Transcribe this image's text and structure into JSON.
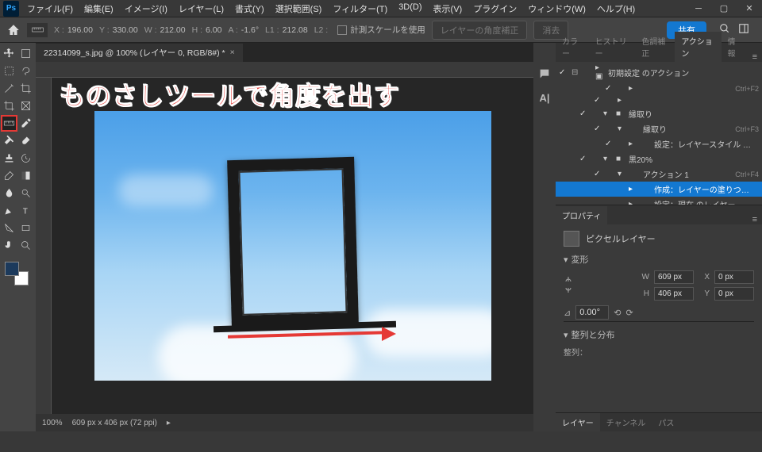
{
  "menu": [
    "ファイル(F)",
    "編集(E)",
    "イメージ(I)",
    "レイヤー(L)",
    "書式(Y)",
    "選択範囲(S)",
    "フィルター(T)",
    "3D(D)",
    "表示(V)",
    "プラグイン",
    "ウィンドウ(W)",
    "ヘルプ(H)"
  ],
  "options": {
    "x_label": "X :",
    "x": "196.00",
    "y_label": "Y :",
    "y": "330.00",
    "w_label": "W :",
    "w": "212.00",
    "h_label": "H :",
    "h": "6.00",
    "a_label": "A :",
    "a": "-1.6°",
    "l1_label": "L1 :",
    "l1": "212.08",
    "l2_label": "L2 :",
    "l2": "",
    "use_scale": "計測スケールを使用",
    "straighten": "レイヤーの角度補正",
    "clear": "消去",
    "share": "共有"
  },
  "doc": {
    "tab": "22314099_s.jpg @ 100% (レイヤー 0, RGB/8#) *"
  },
  "overlay": "ものさしツールで角度を出す",
  "status": {
    "zoom": "100%",
    "dims": "609 px x 406 px (72 ppi)"
  },
  "panels": {
    "top_tabs": [
      "カラー",
      "ヒストリー",
      "色調補正",
      "アクション",
      "情報"
    ],
    "top_active": 3,
    "actions": [
      {
        "chk": "✓",
        "fold": "⊟",
        "icon": "▸ ▣",
        "label": "初期設定 のアクション",
        "shortcut": "",
        "depth": 0
      },
      {
        "chk": "✓",
        "fold": "",
        "icon": "",
        "label": "",
        "shortcut": "Ctrl+F2",
        "depth": 3,
        "twisty": "▸"
      },
      {
        "chk": "✓",
        "fold": "",
        "icon": "",
        "label": "",
        "shortcut": "",
        "depth": 2,
        "twisty": "▸"
      },
      {
        "chk": "✓",
        "fold": "",
        "icon": "■",
        "label": "縁取り",
        "shortcut": "",
        "depth": 1,
        "twisty": "▾"
      },
      {
        "chk": "✓",
        "fold": "",
        "icon": "",
        "label": "縁取り",
        "shortcut": "Ctrl+F3",
        "depth": 2,
        "twisty": "▾"
      },
      {
        "chk": "✓",
        "fold": "",
        "icon": "",
        "label": "設定：レイヤースタイル ： 現在のレイ...",
        "shortcut": "",
        "depth": 3,
        "twisty": "▸"
      },
      {
        "chk": "✓",
        "fold": "",
        "icon": "■",
        "label": "黒20%",
        "shortcut": "",
        "depth": 1,
        "twisty": "▾"
      },
      {
        "chk": "✓",
        "fold": "",
        "icon": "",
        "label": "アクション 1",
        "shortcut": "Ctrl+F4",
        "depth": 2,
        "twisty": "▾"
      },
      {
        "chk": "",
        "fold": "",
        "icon": "",
        "label": "作成：レイヤーの塗りつぶし",
        "shortcut": "",
        "depth": 3,
        "twisty": "▸",
        "selected": true
      },
      {
        "chk": "",
        "fold": "",
        "icon": "",
        "label": "設定：現在 のレイヤー",
        "shortcut": "",
        "depth": 3,
        "twisty": "▸"
      }
    ],
    "props_title": "プロパティ",
    "pixel_layer": "ピクセルレイヤー",
    "transform_title": "変形",
    "transform": {
      "w_label": "W",
      "w": "609 px",
      "x_label": "X",
      "x": "0 px",
      "h_label": "H",
      "h": "406 px",
      "y_label": "Y",
      "y": "0 px",
      "angle_label": "⊿",
      "angle": "0.00°"
    },
    "align_title": "整列と分布",
    "align_label": "整列：",
    "bottom_tabs": [
      "レイヤー",
      "チャンネル",
      "パス"
    ]
  }
}
